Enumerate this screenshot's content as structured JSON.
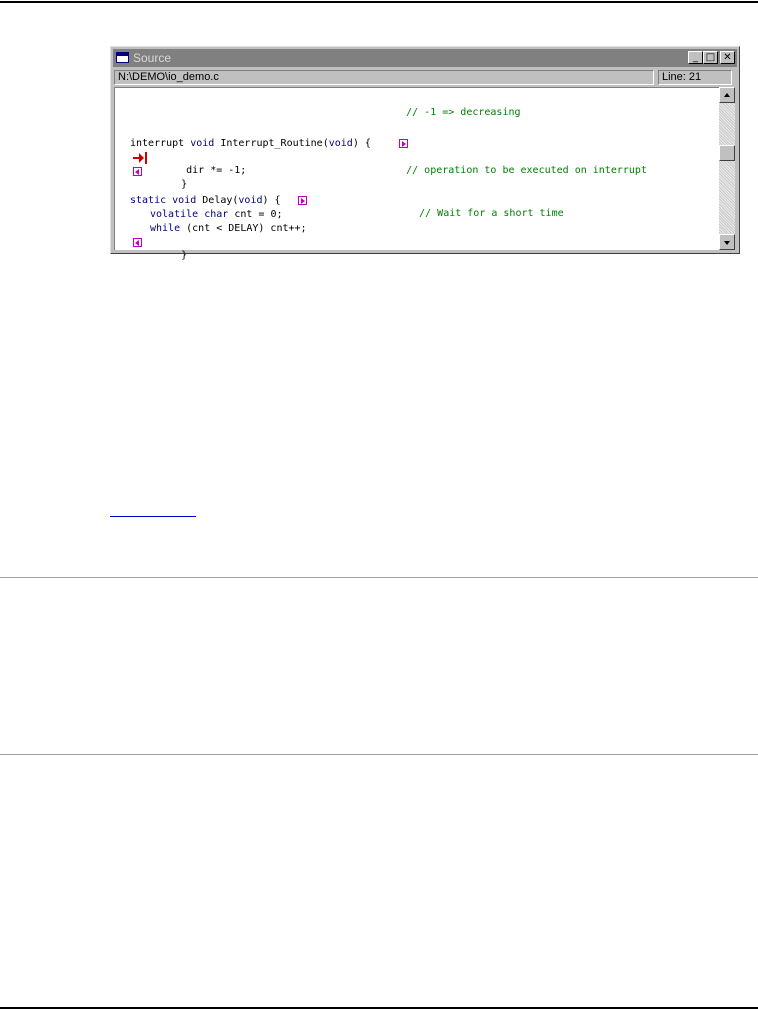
{
  "window": {
    "title": "Source",
    "status": {
      "path": "N:\\DEMO\\io_demo.c",
      "line": "Line: 21"
    },
    "buttons": {
      "minimize": "_",
      "maximize": "□",
      "close": "✕"
    }
  },
  "code": {
    "line1": {
      "comment": "// -1 => decreasing"
    },
    "line2": {
      "kw1": "interrupt",
      "kw2": "void",
      "name": "Interrupt_Routine(",
      "kw3": "void",
      "rest": ") {"
    },
    "line3": {
      "code": "dir *= -1;",
      "comment": "// operation to be executed on interrupt"
    },
    "line4": {
      "code": "}"
    },
    "line5": {
      "kw1": "static",
      "kw2": "void",
      "name": "Delay(",
      "kw3": "void",
      "rest": ") {",
      "comment": "// Wait for a short time"
    },
    "line6": {
      "kw1": "volatile",
      "kw2": "char",
      "rest": "cnt = 0;"
    },
    "line7": {
      "kw": "while",
      "rest": "(cnt < DELAY) cnt++;"
    },
    "line8": {
      "code": "}"
    }
  },
  "colors": {
    "keyword": "#000080",
    "comment": "#008000",
    "marker": "#c000c0",
    "arrow": "#cc0000"
  },
  "icons": {
    "window": "window-icon",
    "marker_start": "block-start-marker-icon",
    "marker_end": "block-end-marker-icon",
    "current_line": "current-line-arrow-icon"
  }
}
